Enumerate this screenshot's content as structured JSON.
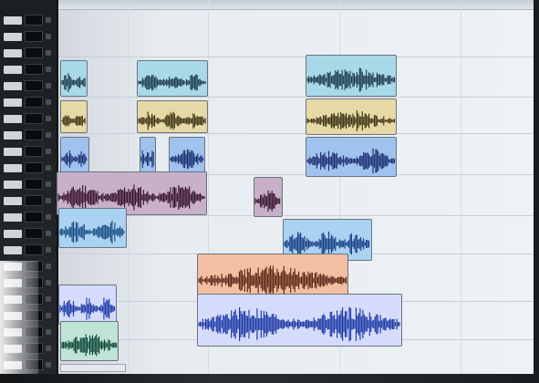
{
  "app": {
    "name": ""
  },
  "mixer": {
    "channels": [
      {
        "label": "",
        "meter": ""
      },
      {
        "label": "",
        "meter": ""
      },
      {
        "label": "",
        "meter": ""
      },
      {
        "label": "",
        "meter": ""
      },
      {
        "label": "",
        "meter": ""
      },
      {
        "label": "",
        "meter": ""
      },
      {
        "label": "",
        "meter": ""
      },
      {
        "label": "",
        "meter": ""
      },
      {
        "label": "",
        "meter": ""
      },
      {
        "label": "",
        "meter": ""
      },
      {
        "label": "",
        "meter": ""
      },
      {
        "label": "",
        "meter": ""
      },
      {
        "label": "",
        "meter": ""
      },
      {
        "label": "",
        "meter": ""
      },
      {
        "label": "",
        "meter": ""
      },
      {
        "label": "",
        "meter": ""
      },
      {
        "label": "",
        "meter": ""
      },
      {
        "label": "",
        "meter": ""
      },
      {
        "label": "",
        "meter": ""
      },
      {
        "label": "",
        "meter": ""
      },
      {
        "label": "",
        "meter": ""
      },
      {
        "label": "",
        "meter": ""
      }
    ]
  },
  "clips": [
    {
      "track": 1,
      "name": "",
      "color": "#a9d9e8",
      "wave": "#1d3d4d"
    },
    {
      "track": 1,
      "name": "",
      "color": "#a9d9e8",
      "wave": "#1d3d4d"
    },
    {
      "track": 1,
      "name": "",
      "color": "#a9d9e8",
      "wave": "#1d3d4d"
    },
    {
      "track": 2,
      "name": "",
      "color": "#e6d9a6",
      "wave": "#3d3515"
    },
    {
      "track": 2,
      "name": "",
      "color": "#e6d9a6",
      "wave": "#3d3515"
    },
    {
      "track": 2,
      "name": "",
      "color": "#e6d9a6",
      "wave": "#3d3515"
    },
    {
      "track": 3,
      "name": "",
      "color": "#9fc3ee",
      "wave": "#1d2f72"
    },
    {
      "track": 3,
      "name": "",
      "color": "#9fc3ee",
      "wave": "#1d2f72"
    },
    {
      "track": 3,
      "name": "",
      "color": "#9fc3ee",
      "wave": "#1d2f72"
    },
    {
      "track": 3,
      "name": "",
      "color": "#9fc3ee",
      "wave": "#1d2f72"
    },
    {
      "track": 4,
      "name": "",
      "color": "#c7b0c8",
      "wave": "#3a1630"
    },
    {
      "track": 4,
      "name": "",
      "color": "#c7b0c8",
      "wave": "#3a1630"
    },
    {
      "track": 5,
      "name": "",
      "color": "#aad3f2",
      "wave": "#1a4f86"
    },
    {
      "track": 5,
      "name": "",
      "color": "#aad3f2",
      "wave": "#1a3f86"
    },
    {
      "track": 6,
      "name": "",
      "color": "#f2bfa2",
      "wave": "#5b2a18"
    },
    {
      "track": 7,
      "name": "",
      "color": "#d5dcfb",
      "wave": "#1e3aa6"
    },
    {
      "track": 7,
      "name": "",
      "color": "#d5dcfb",
      "wave": "#1e3aa6"
    },
    {
      "track": 8,
      "name": "",
      "color": "#bfe3d7",
      "wave": "#0f4a3a"
    }
  ],
  "status": {
    "timecode": ""
  }
}
